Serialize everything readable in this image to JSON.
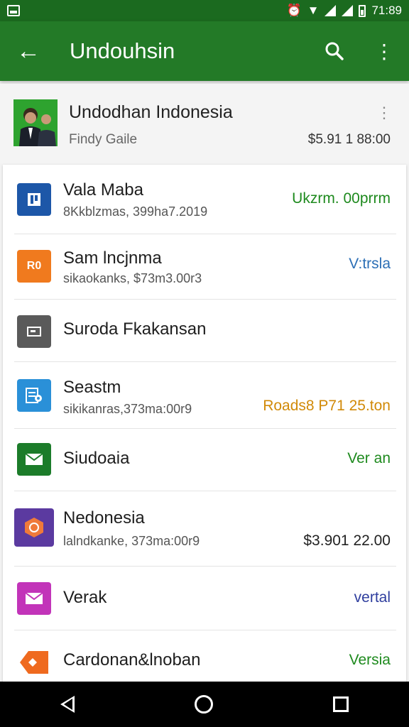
{
  "status_bar": {
    "time": "71:89"
  },
  "app_bar": {
    "back_glyph": "←",
    "title": "Undouhsin",
    "search_glyph": "⚲",
    "more_glyph": "⋮"
  },
  "account": {
    "name": "Undodhan Indonesia",
    "subtitle": "Findy Gaile",
    "amount": "$5.91 1 88:00",
    "more_glyph": "⋮"
  },
  "rows": [
    {
      "title": "Vala Maba",
      "subtitle": "8Kkblzmas, 399ha7.2019",
      "value": "Ukzrm. 00prrm",
      "value_color": "#1e8a1e",
      "icon": "document-icon",
      "icon_color": "#1d57a8",
      "icon_glyph": "▮"
    },
    {
      "title": "Sam lncjnma",
      "subtitle": "sikaokanks, $73m3.00r3",
      "value": "V:trsla",
      "value_color": "#2c6fb6",
      "icon": "briefcase-icon",
      "icon_color": "#f07a1e",
      "icon_glyph": "R0"
    },
    {
      "title": "Suroda Fkakansan",
      "subtitle": "",
      "value": "",
      "value_color": "#333333",
      "icon": "card-icon",
      "icon_color": "#5a5a5a",
      "icon_glyph": "▭"
    },
    {
      "title": "Seastm",
      "subtitle": "sikikanras,373ma:00r9",
      "value": "Roads8 P71 25.ton",
      "value_color": "#d18a08",
      "icon": "notes-icon",
      "icon_color": "#2a90d8",
      "icon_glyph": "≡"
    },
    {
      "title": "Siudoaia",
      "subtitle": "",
      "value": "Ver an",
      "value_color": "#1e8a1e",
      "icon": "mail-icon",
      "icon_color": "#1c7c2a",
      "icon_glyph": "✉"
    },
    {
      "title": "Nedonesia",
      "subtitle": "lalndkanke, 373ma:00r9",
      "value": "$3.901 22.00",
      "value_color": "#222222",
      "value2_color": "#c47a00",
      "icon": "badge-icon",
      "icon_color": "#5b3aa0",
      "icon_glyph": "◈"
    },
    {
      "title": "Verak",
      "subtitle": "",
      "value": "vertal",
      "value_color": "#2f3e9e",
      "icon": "envelope-icon",
      "icon_color": "#c234b9",
      "icon_glyph": "✉"
    },
    {
      "title": "Cardonan&lnoban",
      "subtitle": "",
      "value": "Versia",
      "value_color": "#1e8a1e",
      "icon": "tag-icon",
      "icon_color": "#ef6a1f",
      "icon_glyph": "◆"
    }
  ]
}
